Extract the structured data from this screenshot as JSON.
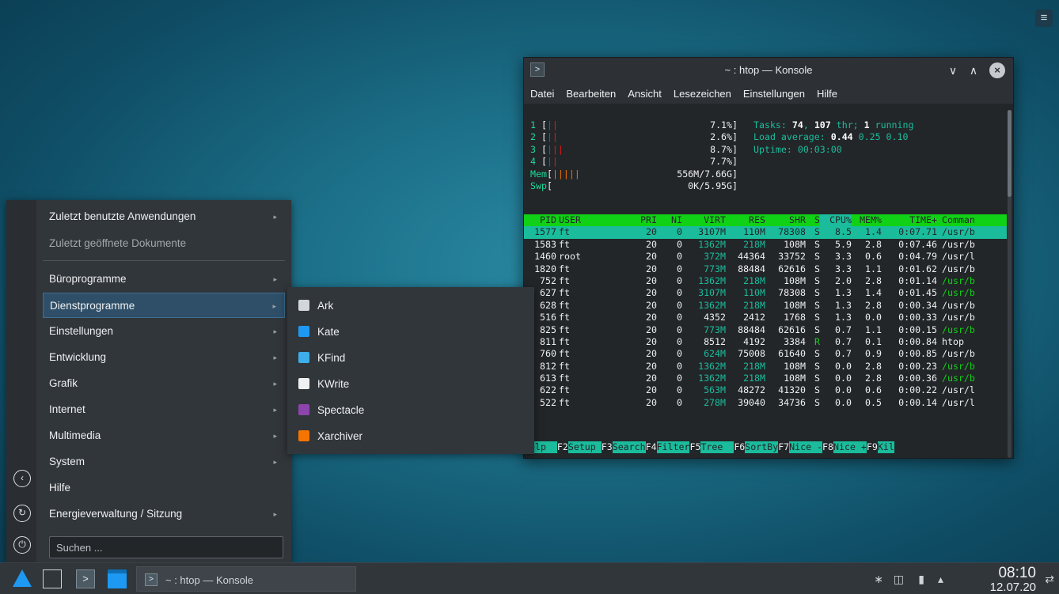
{
  "desktop": {
    "menu_icon": "≡"
  },
  "konsole": {
    "title": "~ : htop — Konsole",
    "app_icon": ">",
    "min_glyph": "∨",
    "max_glyph": "∧",
    "close_glyph": "×",
    "menu": [
      "Datei",
      "Bearbeiten",
      "Ansicht",
      "Lesezeichen",
      "Einstellungen",
      "Hilfe"
    ],
    "cpus": [
      {
        "num": "1",
        "bars": "||",
        "pct": "7.1%]"
      },
      {
        "num": "2",
        "bars": "||",
        "pct": "2.6%]"
      },
      {
        "num": "3",
        "bars": "|||",
        "pct": "8.7%]"
      },
      {
        "num": "4",
        "bars": "||",
        "pct": "7.7%]"
      }
    ],
    "mem": {
      "label": "Mem",
      "bars": "|||||",
      "val": "556M/7.66G]"
    },
    "swp": {
      "label": "Swp",
      "val": "0K/5.95G]"
    },
    "tasks": {
      "prefix": "Tasks: ",
      "n1": "74",
      "sep": ", ",
      "n2": "107",
      "thr": " thr; ",
      "n3": "1",
      "running": " running"
    },
    "load": {
      "prefix": "Load average: ",
      "a": "0.44",
      "rest": " 0.25 0.10"
    },
    "uptime": "Uptime: 00:03:00",
    "header": {
      "pid": "PID",
      "user": "USER",
      "pri": "PRI",
      "ni": "NI",
      "virt": "VIRT",
      "res": "RES",
      "shr": "SHR",
      "s": "S",
      "cpu": "CPU%",
      "mem": "MEM%",
      "time": "TIME+",
      "cmd": "Comman"
    },
    "procs": [
      {
        "pid": "1577",
        "user": "ft",
        "pri": "20",
        "ni": "0",
        "virt": "3107M",
        "res": "110M",
        "shr": "78308",
        "s": "S",
        "cpu": "8.5",
        "mem": "1.4",
        "time": "0:07.71",
        "cmd": "/usr/b"
      },
      {
        "pid": "1583",
        "user": "ft",
        "pri": "20",
        "ni": "0",
        "virt": "1362M",
        "res": "218M",
        "shr": "108M",
        "s": "S",
        "cpu": "5.9",
        "mem": "2.8",
        "time": "0:07.46",
        "cmd": "/usr/b"
      },
      {
        "pid": "1460",
        "user": "root",
        "pri": "20",
        "ni": "0",
        "virt": "372M",
        "res": "44364",
        "shr": "33752",
        "s": "S",
        "cpu": "3.3",
        "mem": "0.6",
        "time": "0:04.79",
        "cmd": "/usr/l"
      },
      {
        "pid": "1820",
        "user": "ft",
        "pri": "20",
        "ni": "0",
        "virt": "773M",
        "res": "88484",
        "shr": "62616",
        "s": "S",
        "cpu": "3.3",
        "mem": "1.1",
        "time": "0:01.62",
        "cmd": "/usr/b"
      },
      {
        "pid": "752",
        "user": "ft",
        "pri": "20",
        "ni": "0",
        "virt": "1362M",
        "res": "218M",
        "shr": "108M",
        "s": "S",
        "cpu": "2.0",
        "mem": "2.8",
        "time": "0:01.14",
        "cmd": "/usr/b"
      },
      {
        "pid": "627",
        "user": "ft",
        "pri": "20",
        "ni": "0",
        "virt": "3107M",
        "res": "110M",
        "shr": "78308",
        "s": "S",
        "cpu": "1.3",
        "mem": "1.4",
        "time": "0:01.45",
        "cmd": "/usr/b"
      },
      {
        "pid": "628",
        "user": "ft",
        "pri": "20",
        "ni": "0",
        "virt": "1362M",
        "res": "218M",
        "shr": "108M",
        "s": "S",
        "cpu": "1.3",
        "mem": "2.8",
        "time": "0:00.34",
        "cmd": "/usr/b"
      },
      {
        "pid": "516",
        "user": "ft",
        "pri": "20",
        "ni": "0",
        "virt": "4352",
        "res": "2412",
        "shr": "1768",
        "s": "S",
        "cpu": "1.3",
        "mem": "0.0",
        "time": "0:00.33",
        "cmd": "/usr/b"
      },
      {
        "pid": "825",
        "user": "ft",
        "pri": "20",
        "ni": "0",
        "virt": "773M",
        "res": "88484",
        "shr": "62616",
        "s": "S",
        "cpu": "0.7",
        "mem": "1.1",
        "time": "0:00.15",
        "cmd": "/usr/b"
      },
      {
        "pid": "811",
        "user": "ft",
        "pri": "20",
        "ni": "0",
        "virt": "8512",
        "res": "4192",
        "shr": "3384",
        "s": "R",
        "cpu": "0.7",
        "mem": "0.1",
        "time": "0:00.84",
        "cmd": "htop"
      },
      {
        "pid": "760",
        "user": "ft",
        "pri": "20",
        "ni": "0",
        "virt": "624M",
        "res": "75008",
        "shr": "61640",
        "s": "S",
        "cpu": "0.7",
        "mem": "0.9",
        "time": "0:00.85",
        "cmd": "/usr/b"
      },
      {
        "pid": "812",
        "user": "ft",
        "pri": "20",
        "ni": "0",
        "virt": "1362M",
        "res": "218M",
        "shr": "108M",
        "s": "S",
        "cpu": "0.0",
        "mem": "2.8",
        "time": "0:00.23",
        "cmd": "/usr/b"
      },
      {
        "pid": "613",
        "user": "ft",
        "pri": "20",
        "ni": "0",
        "virt": "1362M",
        "res": "218M",
        "shr": "108M",
        "s": "S",
        "cpu": "0.0",
        "mem": "2.8",
        "time": "0:00.36",
        "cmd": "/usr/b"
      },
      {
        "pid": "622",
        "user": "ft",
        "pri": "20",
        "ni": "0",
        "virt": "563M",
        "res": "48272",
        "shr": "41320",
        "s": "S",
        "cpu": "0.0",
        "mem": "0.6",
        "time": "0:00.22",
        "cmd": "/usr/l"
      },
      {
        "pid": "522",
        "user": "ft",
        "pri": "20",
        "ni": "0",
        "virt": "278M",
        "res": "39040",
        "shr": "34736",
        "s": "S",
        "cpu": "0.0",
        "mem": "0.5",
        "time": "0:00.14",
        "cmd": "/usr/l"
      }
    ],
    "fkeys": [
      {
        "key": "",
        "label": "Help  "
      },
      {
        "key": "F2",
        "label": "Setup "
      },
      {
        "key": "F3",
        "label": "Search"
      },
      {
        "key": "F4",
        "label": "Filter"
      },
      {
        "key": "F5",
        "label": "Tree  "
      },
      {
        "key": "F6",
        "label": "SortBy"
      },
      {
        "key": "F7",
        "label": "Nice -"
      },
      {
        "key": "F8",
        "label": "Nice +"
      },
      {
        "key": "F9",
        "label": "Kil"
      }
    ]
  },
  "launcher": {
    "items": [
      {
        "label": "Zuletzt benutzte Anwendungen",
        "arrow": "▸"
      },
      {
        "label": "Zuletzt geöffnete Dokumente"
      },
      {
        "label": "Büroprogramme",
        "arrow": "▸"
      },
      {
        "label": "Dienstprogramme",
        "arrow": "▸"
      },
      {
        "label": "Einstellungen",
        "arrow": "▸"
      },
      {
        "label": "Entwicklung",
        "arrow": "▸"
      },
      {
        "label": "Grafik",
        "arrow": "▸"
      },
      {
        "label": "Internet",
        "arrow": "▸"
      },
      {
        "label": "Multimedia",
        "arrow": "▸"
      },
      {
        "label": "System",
        "arrow": "▸"
      },
      {
        "label": "Hilfe"
      },
      {
        "label": "Energieverwaltung / Sitzung",
        "arrow": "▸"
      }
    ],
    "search_placeholder": "Suchen ...",
    "side_icons": {
      "back": "‹",
      "refresh": "↻",
      "power": "⏻"
    }
  },
  "submenu": [
    {
      "label": "Ark",
      "icon_color": "#d4d7da"
    },
    {
      "label": "Kate",
      "icon_color": "#1d99f3"
    },
    {
      "label": "KFind",
      "icon_color": "#3daee9"
    },
    {
      "label": "KWrite",
      "icon_color": "#eff0f1"
    },
    {
      "label": "Spectacle",
      "icon_color": "#8e44ad"
    },
    {
      "label": "Xarchiver",
      "icon_color": "#f67400"
    }
  ],
  "taskbar": {
    "task_label": "~ : htop — Konsole",
    "task_icon": ">",
    "konsole_icon": ">",
    "tray": {
      "bluetooth": "∗",
      "network": "◫",
      "battery": "▮",
      "expand": "▴",
      "config": "⇄"
    },
    "time": "08:10",
    "date": "12.07.20"
  }
}
